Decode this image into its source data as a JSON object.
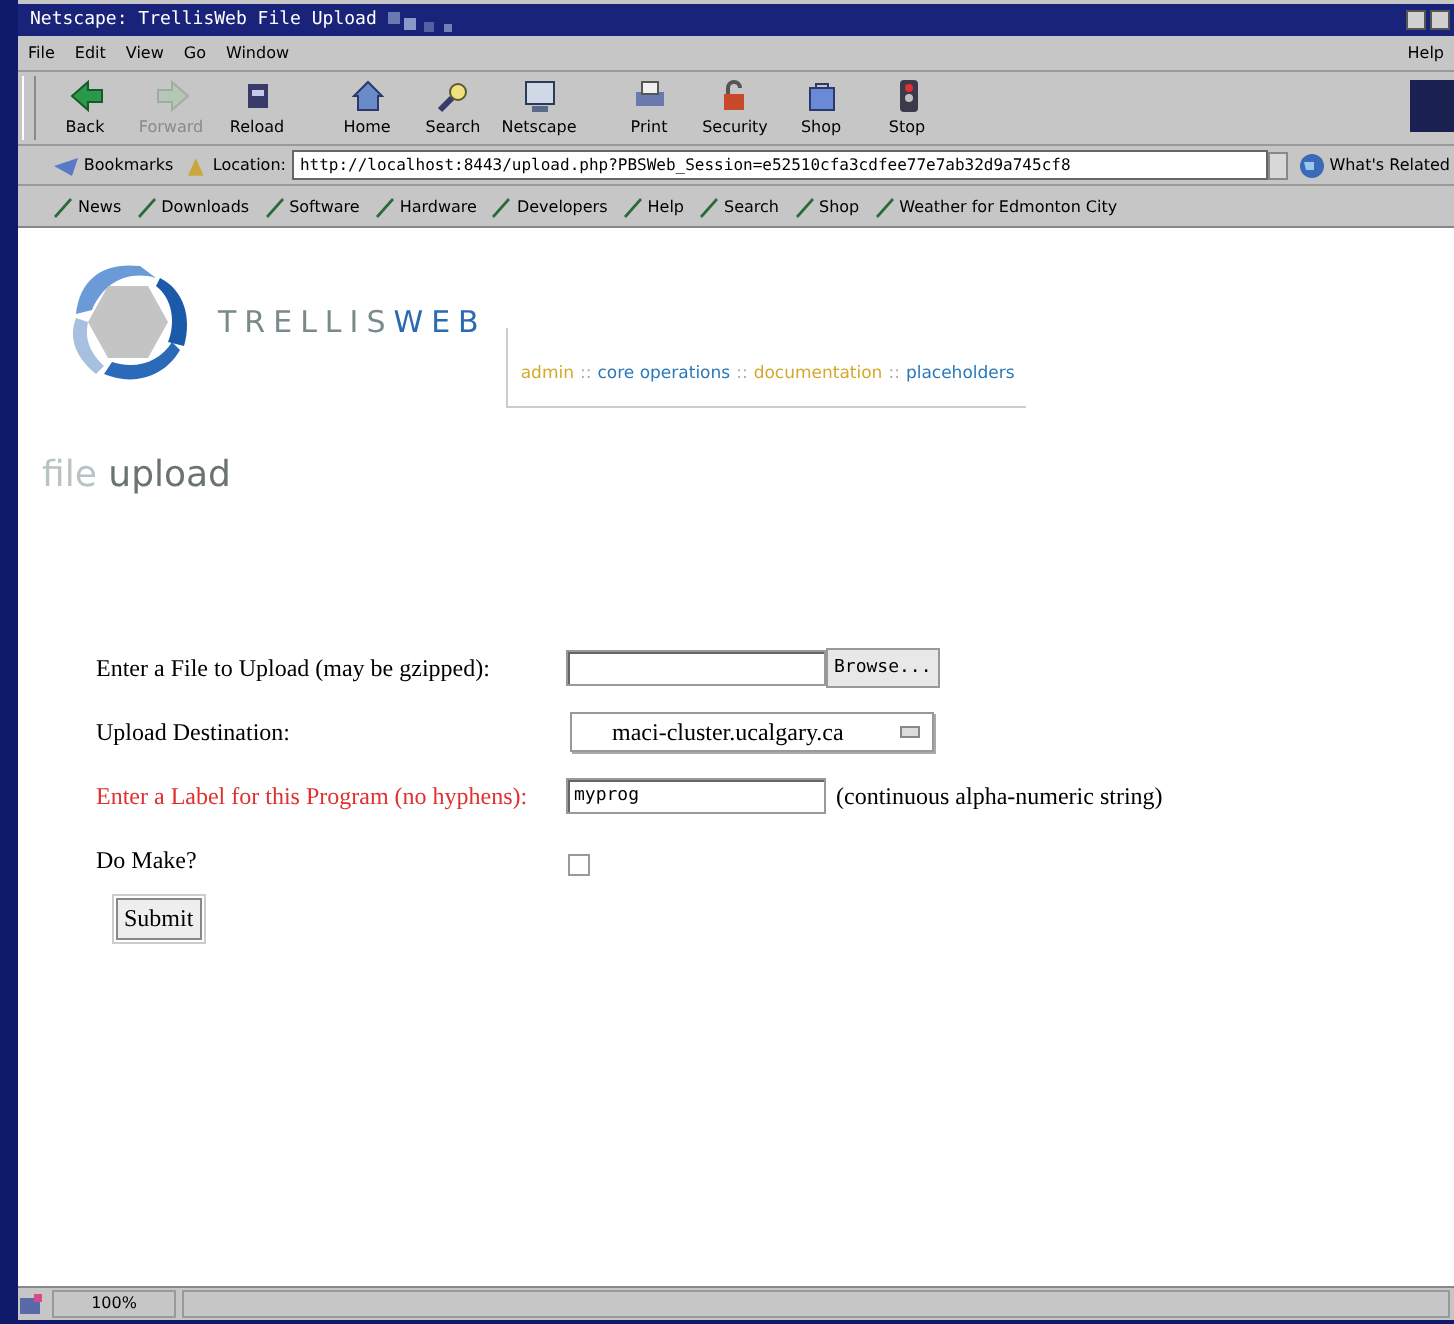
{
  "window": {
    "title": "Netscape: TrellisWeb File Upload"
  },
  "menu": [
    {
      "label": "File"
    },
    {
      "label": "Edit"
    },
    {
      "label": "View"
    },
    {
      "label": "Go"
    },
    {
      "label": "Window"
    }
  ],
  "help_menu": "Help",
  "toolbar": [
    {
      "label": "Back",
      "disabled": false
    },
    {
      "label": "Forward",
      "disabled": true
    },
    {
      "label": "Reload",
      "disabled": false
    },
    {
      "label": "Home",
      "disabled": false
    },
    {
      "label": "Search",
      "disabled": false
    },
    {
      "label": "Netscape",
      "disabled": false
    },
    {
      "label": "Print",
      "disabled": false
    },
    {
      "label": "Security",
      "disabled": false
    },
    {
      "label": "Shop",
      "disabled": false
    },
    {
      "label": "Stop",
      "disabled": false
    }
  ],
  "location_bar": {
    "bookmarks": "Bookmarks",
    "label": "Location:",
    "url": "http://localhost:8443/upload.php?PBSWeb_Session=e52510cfa3cdfee77e7ab32d9a745cf8",
    "related": "What's Related"
  },
  "personal_toolbar": [
    {
      "label": "News"
    },
    {
      "label": "Downloads"
    },
    {
      "label": "Software"
    },
    {
      "label": "Hardware"
    },
    {
      "label": "Developers"
    },
    {
      "label": "Help"
    },
    {
      "label": "Search"
    },
    {
      "label": "Shop"
    },
    {
      "label": "Weather for Edmonton City"
    }
  ],
  "page": {
    "logo": {
      "light": "TRELLIS",
      "bold": "WEB"
    },
    "nav": [
      {
        "kind": "link",
        "text": "admin",
        "color": "#d4a82a"
      },
      {
        "kind": "separator",
        "text": "::"
      },
      {
        "kind": "link",
        "text": "core operations",
        "color": "#2a78b8"
      },
      {
        "kind": "separator",
        "text": "::"
      },
      {
        "kind": "link",
        "text": "documentation",
        "color": "#d4a82a"
      },
      {
        "kind": "separator",
        "text": "::"
      },
      {
        "kind": "link",
        "text": "placeholders",
        "color": "#2a78b8"
      }
    ],
    "heading": {
      "light": "file",
      "dark": "upload"
    },
    "form": [
      {
        "kind": "file",
        "label": "Enter a File to Upload (may be gzipped):",
        "required": false,
        "button": "Browse..."
      },
      {
        "kind": "select",
        "label": "Upload Destination:",
        "required": false,
        "value": "maci-cluster.ucalgary.ca"
      },
      {
        "kind": "text",
        "label": "Enter a Label for this Program (no hyphens):",
        "required": true,
        "value": "myprog",
        "note": "(continuous alpha-numeric string)"
      },
      {
        "kind": "checkbox",
        "label": "Do Make?",
        "required": false,
        "checked": false
      }
    ],
    "submit": "Submit"
  },
  "status_bar": {
    "zoom": "100%"
  }
}
